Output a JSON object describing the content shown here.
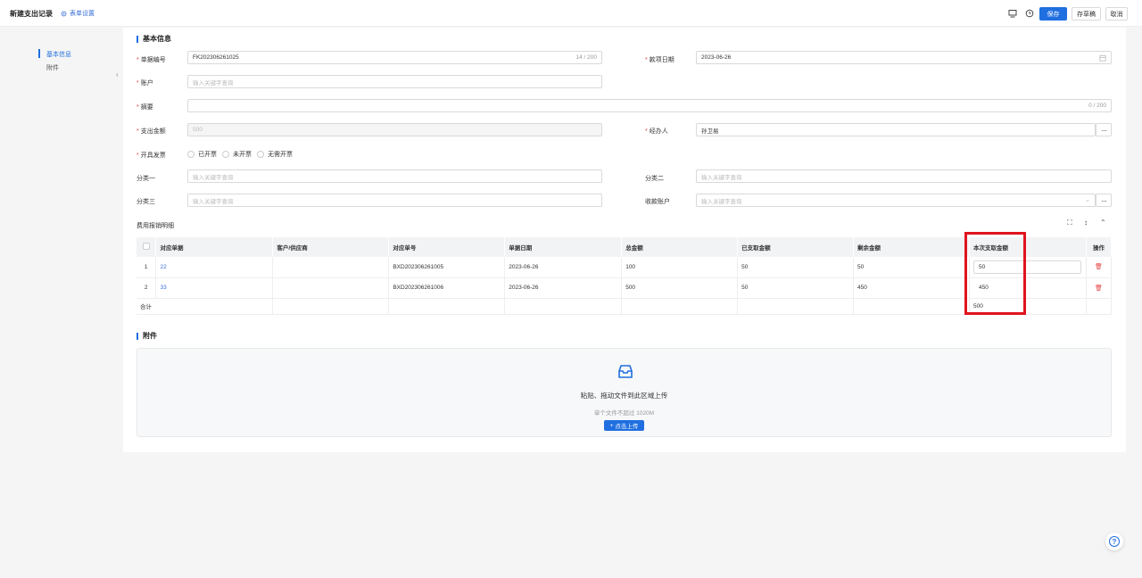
{
  "header": {
    "title": "新建支出记录",
    "form_settings": "表单设置",
    "save": "保存",
    "save_draft": "存草稿",
    "cancel": "取消"
  },
  "sidenav": {
    "items": [
      {
        "label": "基本信息",
        "active": true
      },
      {
        "label": "附件",
        "active": false
      }
    ]
  },
  "basic_info": {
    "section_title": "基本信息",
    "doc_no": {
      "label": "单据编号",
      "value": "FK202306261025",
      "counter": "14 / 200"
    },
    "date": {
      "label": "款项日期",
      "value": "2023-06-26"
    },
    "account": {
      "label": "账户",
      "placeholder": "输入关键字查询"
    },
    "summary": {
      "label": "摘要",
      "counter": "0 / 200"
    },
    "amount": {
      "label": "支出金额",
      "value": "500"
    },
    "handler": {
      "label": "经办人",
      "value": "孙卫易"
    },
    "invoice": {
      "label": "开具发票",
      "options": [
        "已开票",
        "未开票",
        "无需开票"
      ]
    },
    "cat1": {
      "label": "分类一",
      "placeholder": "输入关键字查询"
    },
    "cat2": {
      "label": "分类二",
      "placeholder": "输入关键字查询"
    },
    "cat3": {
      "label": "分类三",
      "placeholder": "输入关键字查询"
    },
    "payee_account": {
      "label": "收款账户",
      "placeholder": "输入关键字查询"
    }
  },
  "detail": {
    "title": "费用报销明细",
    "columns": [
      "对应单据",
      "客户/供应商",
      "对应单号",
      "单据日期",
      "总金额",
      "已支取金额",
      "剩余金额",
      "本次支取金额",
      "操作"
    ],
    "rows": [
      {
        "idx": "1",
        "doc": "22",
        "party": "",
        "no": "BXD202306261005",
        "date": "2023-06-26",
        "total": "100",
        "paid": "50",
        "remain": "50",
        "this": "50"
      },
      {
        "idx": "2",
        "doc": "33",
        "party": "",
        "no": "BXD202306261006",
        "date": "2023-06-26",
        "total": "500",
        "paid": "50",
        "remain": "450",
        "this": "450"
      }
    ],
    "sum_label": "合计",
    "sum_value": "500"
  },
  "attachments": {
    "section_title": "附件",
    "drop_text": "粘贴、拖动文件到此区域上传",
    "limit_text": "单个文件不超过 1020M",
    "upload_button": "点击上传"
  },
  "colors": {
    "accent": "#1f6fe0",
    "required": "#e54545",
    "highlight": "#e0141e"
  }
}
